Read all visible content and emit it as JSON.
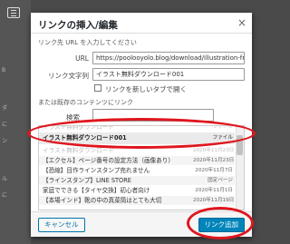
{
  "colors": {
    "accent": "#0085ba",
    "highlight": "#e0161e",
    "backdrop": "#4a4a4a"
  },
  "backdrop": {
    "side_texts": [
      "B",
      "ダ",
      "に",
      "ン",
      "ル",
      "に"
    ]
  },
  "dialog": {
    "title": "リンクの挿入/編集",
    "close_icon": "×",
    "intro": "リンク先 URL を入力してください",
    "url_label": "URL",
    "url_value": "https://poolooyolo.blog/download/illustration-freel",
    "text_label": "リンク文字列",
    "text_value": "イラスト無料ダウンロード001",
    "new_tab_label": "リンクを新しいタブで開く",
    "existing_label": "または既存のコンテンツにリンク",
    "search_label": "検索",
    "search_value": ""
  },
  "results": [
    {
      "title": "イラスト無料ダウンロード001",
      "meta": "ファイル"
    },
    {
      "title": "イラスト無料ダウンロード",
      "meta": "2020年11月23日"
    },
    {
      "title": "【エクセル】ページ番号の設定方法（画像あり）",
      "meta": "2020年11月23日"
    },
    {
      "title": "【恐縮】目作ラインスタンプ売れません",
      "meta": "2020年11月7日"
    },
    {
      "title": "【ラインスタンプ】LINE STORE",
      "meta": "固定ページ"
    },
    {
      "title": "家庭でできる【タイヤ交換】初心者向け",
      "meta": "2020年11月1日"
    },
    {
      "title": "【本場インド】靴の中の真菜筒はとても大切",
      "meta": "2020年11月19日"
    }
  ],
  "footer": {
    "cancel_label": "キャンセル",
    "submit_label": "リンク追加"
  }
}
